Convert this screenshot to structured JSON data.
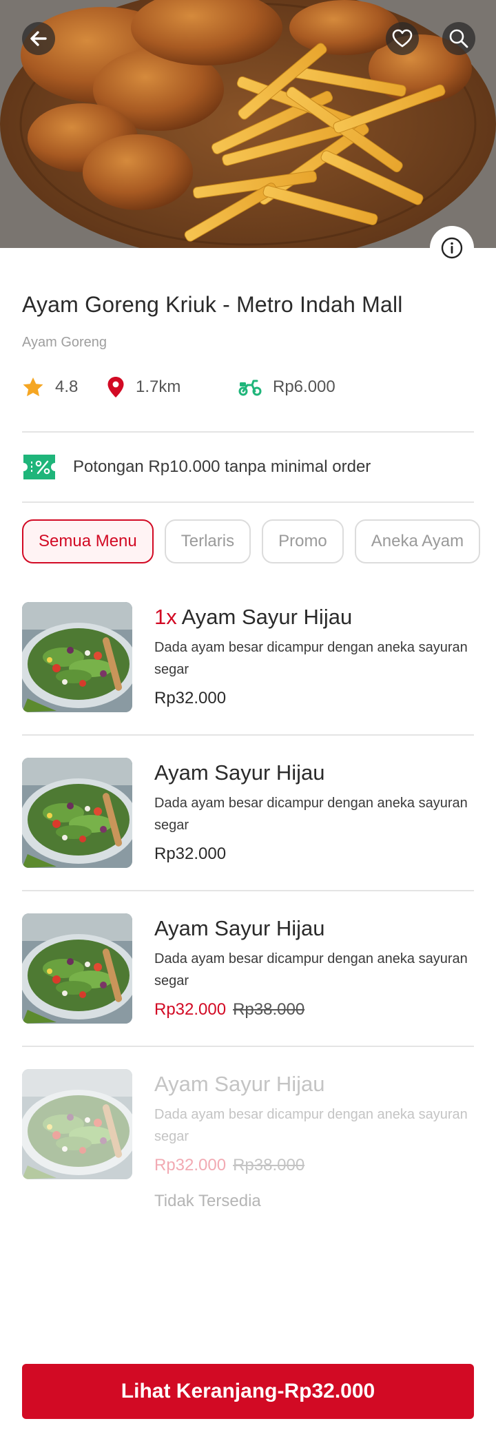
{
  "restaurant": {
    "name": "Ayam Goreng Kriuk - Metro Indah Mall",
    "category": "Ayam Goreng",
    "rating": "4.8",
    "distance": "1.7km",
    "delivery_fee": "Rp6.000"
  },
  "promo": {
    "text": "Potongan Rp10.000 tanpa minimal order",
    "badge_icon": "discount-ticket-icon"
  },
  "tabs": [
    {
      "label": "Semua Menu",
      "active": true
    },
    {
      "label": "Terlaris",
      "active": false
    },
    {
      "label": "Promo",
      "active": false
    },
    {
      "label": "Aneka Ayam",
      "active": false
    }
  ],
  "menu": [
    {
      "qty": "1x",
      "name": "Ayam Sayur Hijau",
      "description": "Dada ayam besar dicampur dengan aneka sayuran segar",
      "price": "Rp32.000",
      "old_price": "",
      "status": ""
    },
    {
      "qty": "",
      "name": "Ayam Sayur Hijau",
      "description": "Dada ayam besar dicampur dengan aneka sayuran segar",
      "price": "Rp32.000",
      "old_price": "",
      "status": ""
    },
    {
      "qty": "",
      "name": "Ayam Sayur Hijau",
      "description": "Dada ayam besar dicampur dengan aneka sayuran segar",
      "price": "Rp32.000",
      "old_price": "Rp38.000",
      "status": ""
    },
    {
      "qty": "",
      "name": "Ayam Sayur Hijau",
      "description": "Dada ayam besar dicampur dengan aneka sayuran segar",
      "price": "Rp32.000",
      "old_price": "Rp38.000",
      "status": "Tidak Tersedia"
    }
  ],
  "cart": {
    "label": "Lihat Keranjang-Rp32.000"
  },
  "colors": {
    "accent": "#d20a24",
    "rating_star": "#f5a623",
    "delivery_green": "#1fb57a"
  },
  "icons": {
    "back": "arrow-left-icon",
    "favorite": "heart-icon",
    "search": "search-icon",
    "info": "info-icon",
    "rating": "star-icon",
    "distance": "location-pin-icon",
    "delivery": "scooter-icon"
  }
}
